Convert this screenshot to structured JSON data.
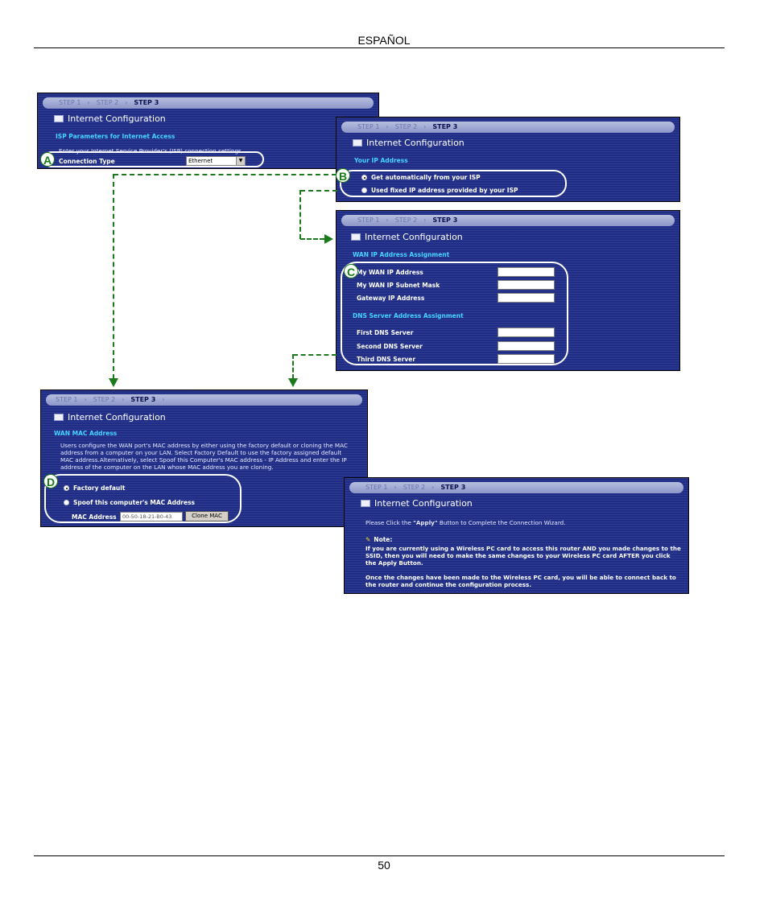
{
  "page": {
    "language_header": "ESPAÑOL",
    "page_number": "50"
  },
  "step_bar": {
    "step1": "STEP 1",
    "step2": "STEP 2",
    "step3": "STEP 3",
    "separator": "›"
  },
  "panel_a": {
    "title": "Internet Configuration",
    "section": "ISP Parameters for Internet Access",
    "intro": "Enter your Internet Service Provider's (ISP) connection settings",
    "connection_type_label": "Connection Type",
    "connection_type_value": "Ethernet"
  },
  "panel_b": {
    "title": "Internet Configuration",
    "section": "Your IP Address",
    "option_auto": "Get automatically from your ISP",
    "option_fixed": "Used fixed IP address provided by your ISP"
  },
  "panel_c": {
    "title": "Internet Configuration",
    "section_wan": "WAN IP Address Assignment",
    "wan_ip_label": "My WAN IP Address",
    "subnet_label": "My WAN IP Subnet Mask",
    "gateway_label": "Gateway IP Address",
    "section_dns": "DNS Server Address Assignment",
    "dns1_label": "First DNS Server",
    "dns2_label": "Second DNS Server",
    "dns3_label": "Third DNS Server"
  },
  "panel_d": {
    "title": "Internet Configuration",
    "section": "WAN MAC Address",
    "description": "Users configure the WAN port's MAC address by either using the factory default or cloning the MAC address from a computer on your LAN. Select Factory Default to use the factory assigned default MAC address.Alternatively, select Spoof this Computer's MAC address - IP Address and enter the IP address of the computer on the LAN whose MAC address you are cloning.",
    "option_factory": "Factory default",
    "option_spoof": "Spoof this computer's MAC Address",
    "mac_label": "MAC Address",
    "mac_value": "00-50-18-21-B0-43",
    "clone_button": "Clone MAC"
  },
  "panel_e": {
    "title": "Internet Configuration",
    "instruction_pre": "Please Click the ",
    "instruction_apply": "\"Apply\"",
    "instruction_post": " Button to Complete the Connection Wizard.",
    "note_label": "Note:",
    "note_text": "If you are currently using a Wireless PC card to access this router AND you made changes to the SSID, then you will need to make the same changes to your Wireless PC card AFTER you click the Apply Button.",
    "note_text2": "Once the changes have been made to the Wireless PC card, you will be able to connect back to the router and continue the configuration process."
  },
  "callouts": {
    "a": "A",
    "b": "B",
    "c": "C",
    "d": "D"
  },
  "colors": {
    "panel_bg": "#1f2d86",
    "section_text": "#46d4ff",
    "connector": "#1b7a1b"
  }
}
